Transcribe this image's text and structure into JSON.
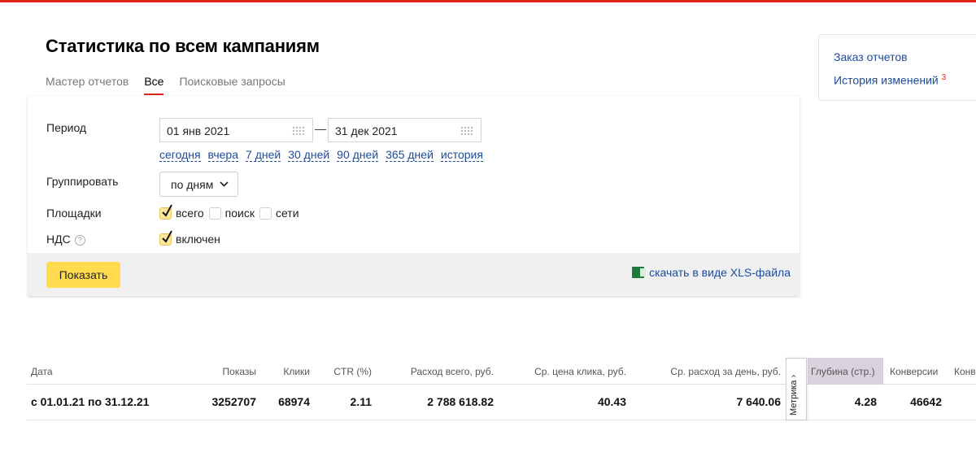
{
  "page": {
    "title": "Статистика по всем кампаниям"
  },
  "tabs": [
    {
      "label": "Мастер отчетов"
    },
    {
      "label": "Все"
    },
    {
      "label": "Поисковые запросы"
    }
  ],
  "side_panel": {
    "order_reports": "Заказ отчетов",
    "change_history": "История изменений",
    "change_history_badge": "3"
  },
  "form": {
    "period_label": "Период",
    "date_from": "01 янв 2021",
    "date_separator": "—",
    "date_to": "31 дек 2021",
    "quick_periods": [
      "сегодня",
      "вчера",
      "7 дней",
      "30 дней",
      "90 дней",
      "365 дней",
      "история"
    ],
    "group_label": "Группировать",
    "group_value": "по дням",
    "platforms_label": "Площадки",
    "platforms": [
      {
        "label": "всего",
        "checked": true
      },
      {
        "label": "поиск",
        "checked": false
      },
      {
        "label": "сети",
        "checked": false
      }
    ],
    "vat_label": "НДС",
    "vat_option": "включен",
    "vat_checked": true,
    "show_button": "Показать",
    "download_xls": "скачать в виде XLS-файла"
  },
  "table": {
    "metrika_label": "Метрика",
    "metrika_arrow": "›",
    "headers": {
      "date": "Дата",
      "impressions": "Показы",
      "clicks": "Клики",
      "ctr": "CTR (%)",
      "spend": "Расход всего, руб.",
      "cpc": "Ср. цена клика, руб.",
      "daily_spend": "Ср. расход за день, руб.",
      "depth": "Глубина (стр.)",
      "conversions": "Конверсии",
      "extra": "Конв"
    },
    "row": {
      "date": "с 01.01.21 по 31.12.21",
      "impressions": "3252707",
      "clicks": "68974",
      "ctr": "2.11",
      "spend": "2 788 618.82",
      "cpc": "40.43",
      "daily_spend": "7 640.06",
      "depth": "4.28",
      "conversions": "46642"
    }
  },
  "colors": {
    "accent": "#e0241a",
    "link": "#1b4b9b",
    "button": "#ffdb4d",
    "metrika_header_bg": "#d8d2de"
  }
}
